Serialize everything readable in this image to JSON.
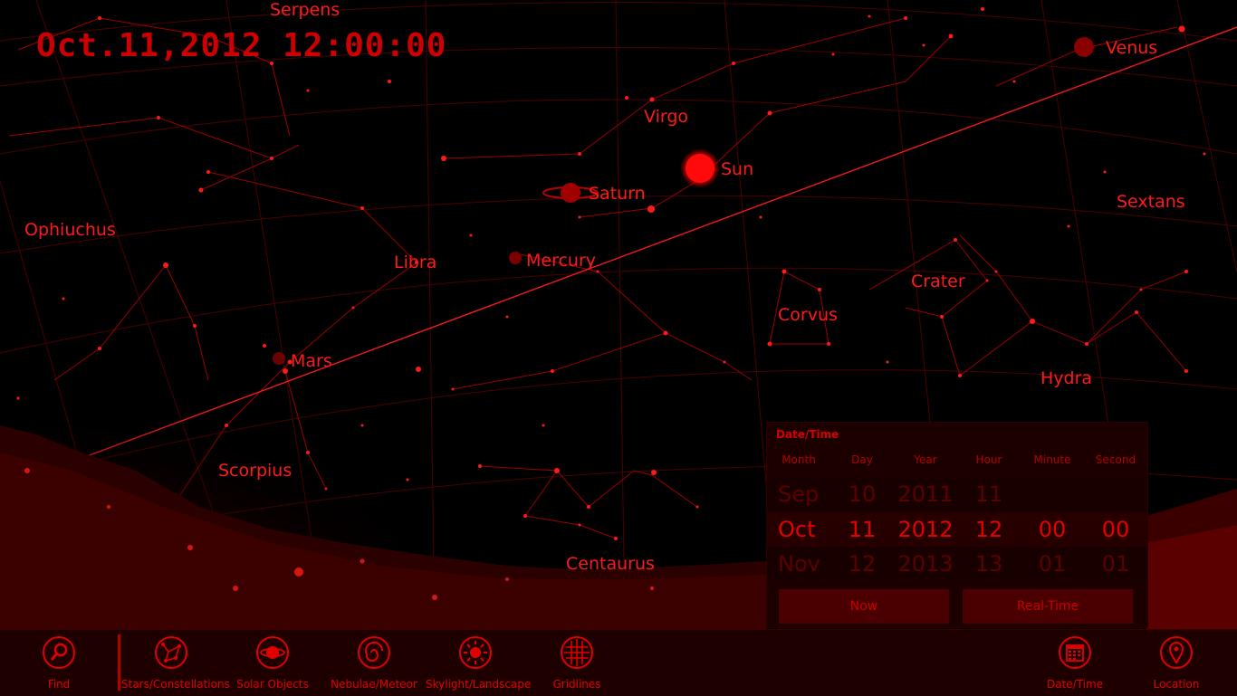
{
  "datetime_display": "Oct.11,2012 12:00:00",
  "sky_labels": {
    "serpens": "Serpens",
    "virgo": "Virgo",
    "venus": "Venus",
    "sun": "Sun",
    "saturn": "Saturn",
    "sextans": "Sextans",
    "ophiuchus": "Ophiuchus",
    "libra": "Libra",
    "mercury": "Mercury",
    "crater": "Crater",
    "corvus": "Corvus",
    "mars": "Mars",
    "hydra": "Hydra",
    "scorpius": "Scorpius",
    "centaurus": "Centaurus"
  },
  "datetime_panel": {
    "title": "Date/Time",
    "columns": [
      "Month",
      "Day",
      "Year",
      "Hour",
      "Minute",
      "Second"
    ],
    "prev_row": [
      "Sep",
      "10",
      "2011",
      "11",
      "",
      ""
    ],
    "current_row": [
      "Oct",
      "11",
      "2012",
      "12",
      "00",
      "00"
    ],
    "next_row": [
      "Nov",
      "12",
      "2013",
      "13",
      "01",
      "01"
    ],
    "now_button": "Now",
    "realtime_button": "Real-Time"
  },
  "appbar": {
    "find": "Find",
    "stars": "Stars/Constellations",
    "solar": "Solar Objects",
    "nebulae": "Nebulae/Meteor",
    "skylight": "Skylight/Landscape",
    "gridlines": "Gridlines",
    "datetime": "Date/Time",
    "location": "Location"
  },
  "colors": {
    "accent": "#e00000",
    "background": "#000000",
    "panel": "#1c0000",
    "appbar": "#1e0000"
  }
}
